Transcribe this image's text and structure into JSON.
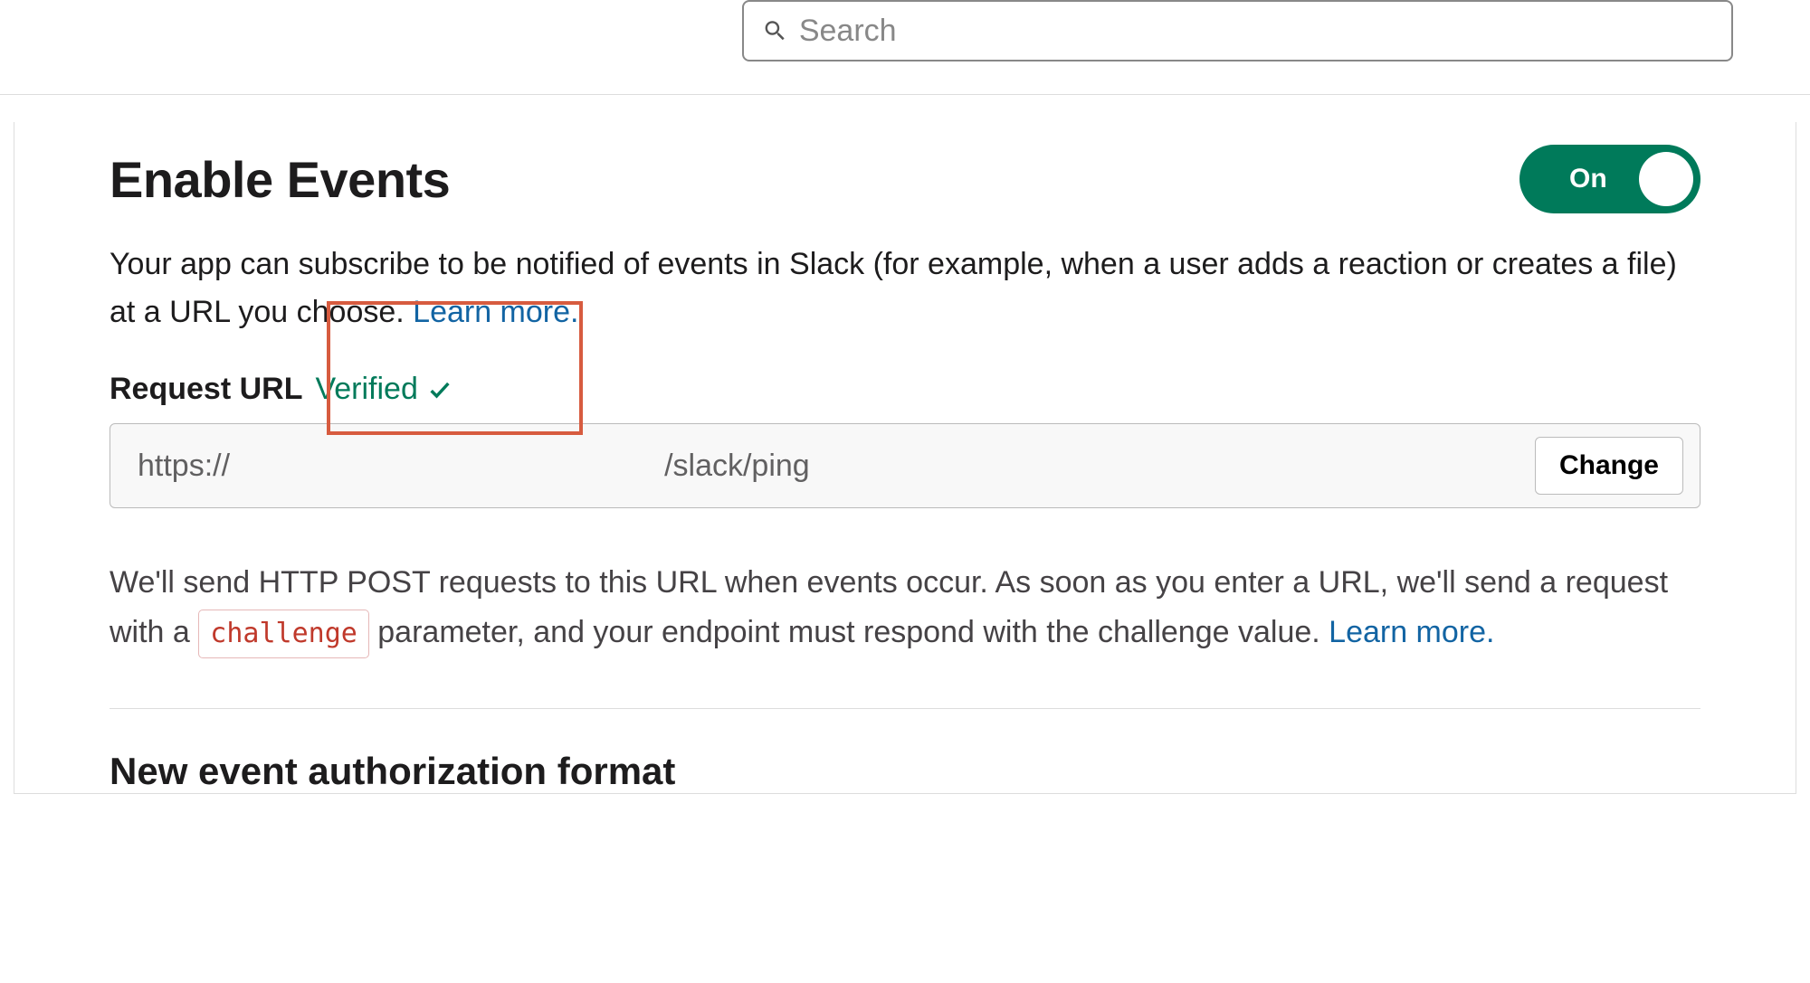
{
  "search": {
    "placeholder": "Search"
  },
  "section": {
    "title": "Enable Events",
    "toggle_label": "On",
    "description_pre": "Your app can subscribe to be notified of events in Slack (for example, when a user adds a reaction or creates a file) at a URL you choose. ",
    "learn_more": "Learn more",
    "request_url_label": "Request URL",
    "verified_label": "Verified",
    "url_scheme": "https://",
    "url_path": "/slack/ping",
    "change_button": "Change",
    "explain_pre": "We'll send HTTP POST requests to this URL when events occur. As soon as you enter a URL, we'll send a request with a ",
    "challenge_code": "challenge",
    "explain_post": " parameter, and your endpoint must respond with the challenge value. ",
    "learn_more2": "Learn more",
    "next_heading": "New event authorization format"
  },
  "colors": {
    "accent_green": "#007a5a",
    "link_blue": "#1264a3",
    "highlight_orange": "#d75b3f"
  }
}
